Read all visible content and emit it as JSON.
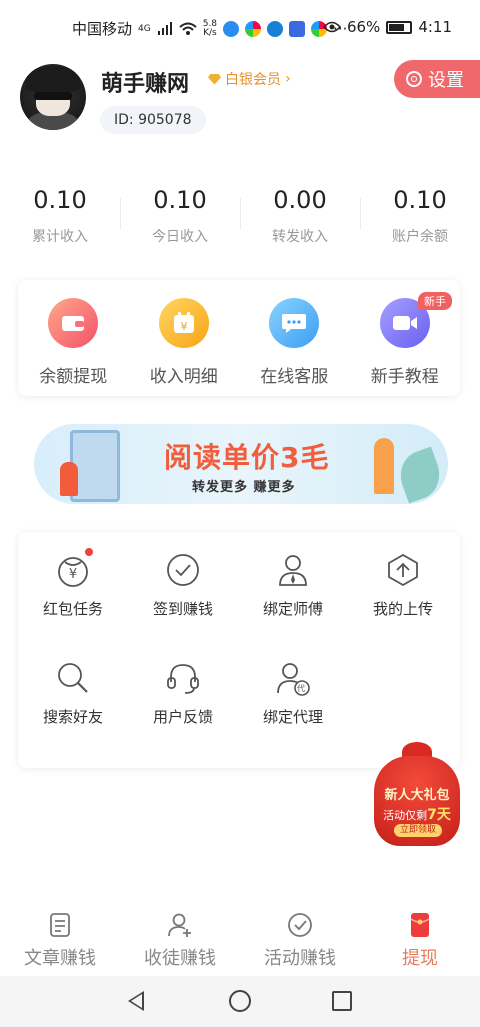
{
  "status_bar": {
    "carrier": "中国移动",
    "network": "4G",
    "speed_value": "5.8",
    "speed_unit": "K/s",
    "battery": "66%",
    "battery_level": 0.66,
    "time": "4:11"
  },
  "profile": {
    "name": "萌手赚网",
    "membership": "白银会员",
    "user_id": "ID: 905078",
    "settings_label": "设置"
  },
  "stats": [
    {
      "value": "0.10",
      "label": "累计收入"
    },
    {
      "value": "0.10",
      "label": "今日收入"
    },
    {
      "value": "0.00",
      "label": "转发收入"
    },
    {
      "value": "0.10",
      "label": "账户余额"
    }
  ],
  "quick_actions": [
    {
      "label": "余额提现",
      "icon": "wallet-icon"
    },
    {
      "label": "收入明细",
      "icon": "calendar-yuan-icon"
    },
    {
      "label": "在线客服",
      "icon": "chat-bubble-icon"
    },
    {
      "label": "新手教程",
      "icon": "video-camera-icon",
      "badge": "新手"
    }
  ],
  "banner": {
    "title": "阅读单价3毛",
    "subtitle": "转发更多 赚更多"
  },
  "grid": [
    {
      "label": "红包任务",
      "icon": "red-packet-icon",
      "dot": true
    },
    {
      "label": "签到赚钱",
      "icon": "check-clock-icon"
    },
    {
      "label": "绑定师傅",
      "icon": "person-tie-icon"
    },
    {
      "label": "我的上传",
      "icon": "upload-icon"
    },
    {
      "label": "搜索好友",
      "icon": "search-icon"
    },
    {
      "label": "用户反馈",
      "icon": "headset-icon"
    },
    {
      "label": "绑定代理",
      "icon": "person-agent-icon",
      "agent_mark": "代"
    }
  ],
  "gift": {
    "title": "新人大礼包",
    "line_prefix": "活动仅剩",
    "days": "7天",
    "button": "立即领取"
  },
  "tabs": [
    {
      "label": "文章赚钱",
      "icon": "article-icon",
      "active": false
    },
    {
      "label": "收徒赚钱",
      "icon": "add-person-icon",
      "active": false
    },
    {
      "label": "活动赚钱",
      "icon": "check-circle-icon",
      "active": false
    },
    {
      "label": "提现",
      "icon": "red-envelope-icon",
      "active": true
    }
  ],
  "colors": {
    "accent": "#f0686c",
    "active_tab": "#e97c5a",
    "member_gold": "#e8902a"
  }
}
